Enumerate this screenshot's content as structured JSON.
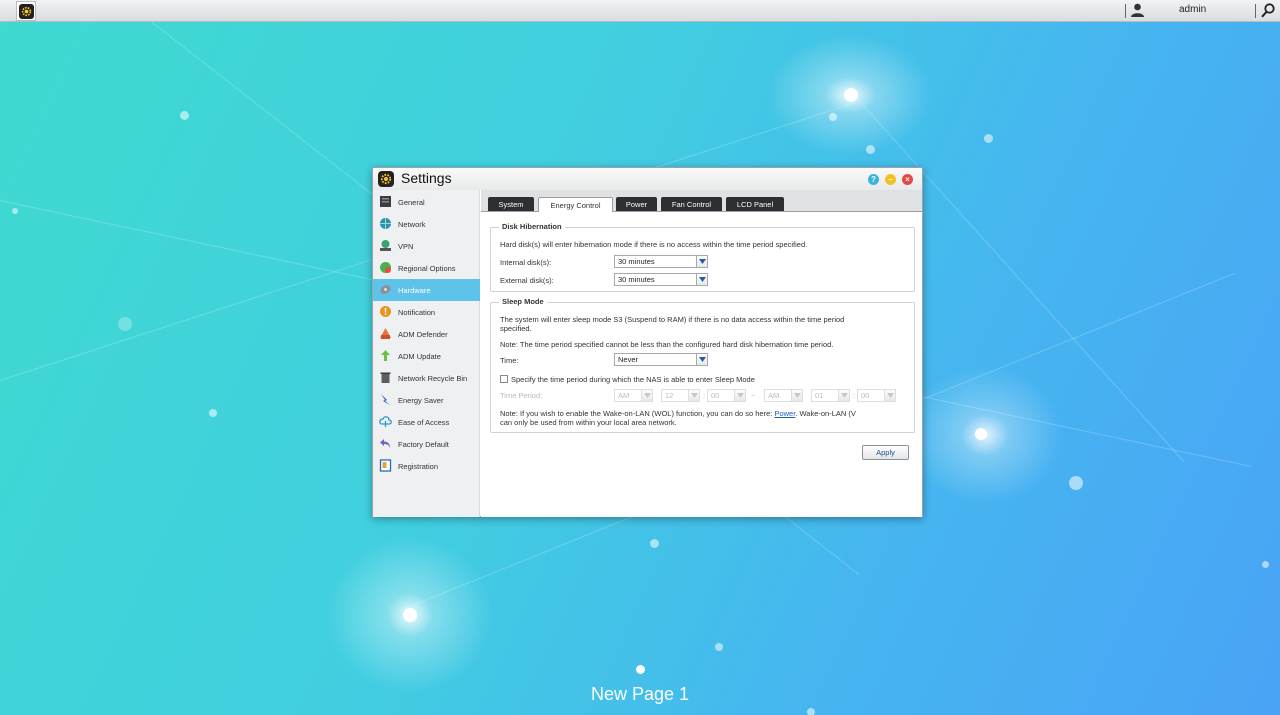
{
  "topbar": {
    "user": "admin"
  },
  "window": {
    "title": "Settings",
    "help_label": "?",
    "minimize_label": "–",
    "close_label": "×"
  },
  "sidebar": {
    "items": [
      {
        "label": "General",
        "icon": "general-icon"
      },
      {
        "label": "Network",
        "icon": "network-icon"
      },
      {
        "label": "VPN",
        "icon": "vpn-icon"
      },
      {
        "label": "Regional Options",
        "icon": "regional-options-icon"
      },
      {
        "label": "Hardware",
        "icon": "hardware-icon",
        "active": true
      },
      {
        "label": "Notification",
        "icon": "notification-icon"
      },
      {
        "label": "ADM Defender",
        "icon": "adm-defender-icon"
      },
      {
        "label": "ADM Update",
        "icon": "adm-update-icon"
      },
      {
        "label": "Network Recycle Bin",
        "icon": "recycle-bin-icon"
      },
      {
        "label": "Energy Saver",
        "icon": "energy-saver-icon"
      },
      {
        "label": "Ease of Access",
        "icon": "ease-of-access-icon"
      },
      {
        "label": "Factory Default",
        "icon": "factory-default-icon"
      },
      {
        "label": "Registration",
        "icon": "registration-icon"
      }
    ]
  },
  "tabs": [
    "System",
    "Energy Control",
    "Power",
    "Fan Control",
    "LCD Panel"
  ],
  "disk_hibernation": {
    "legend": "Disk Hibernation",
    "description": "Hard disk(s) will enter hibernation mode if there is no access within the time period specified.",
    "internal_label": "Internal disk(s):",
    "internal_value": "30 minutes",
    "external_label": "External disk(s):",
    "external_value": "30 minutes"
  },
  "sleep_mode": {
    "legend": "Sleep Mode",
    "description_line1": "The system will enter sleep mode S3 (Suspend to RAM) if there is no data access within the time period",
    "description_line2": "specified.",
    "note1": "Note: The time period specified cannot be less than the configured hard disk hibernation time period.",
    "time_label": "Time:",
    "time_value": "Never",
    "specify_label": "Specify the time period during which the NAS is able to enter Sleep Mode",
    "time_period_label": "Time Period:",
    "start_ampm": "AM",
    "start_hour": "12",
    "start_min": "00",
    "separator": "~",
    "colon": ":",
    "end_ampm": "AM",
    "end_hour": "01",
    "end_min": "00",
    "note2_prefix": "Note: If you wish to enable the Wake-on-LAN (WOL) function, you can do so here: ",
    "note2_link": "Power",
    "note2_suffix": ". Wake-on-LAN (V",
    "note2_line2": "can only be used from within your local area network."
  },
  "apply_label": "Apply",
  "page_label": "New Page 1"
}
